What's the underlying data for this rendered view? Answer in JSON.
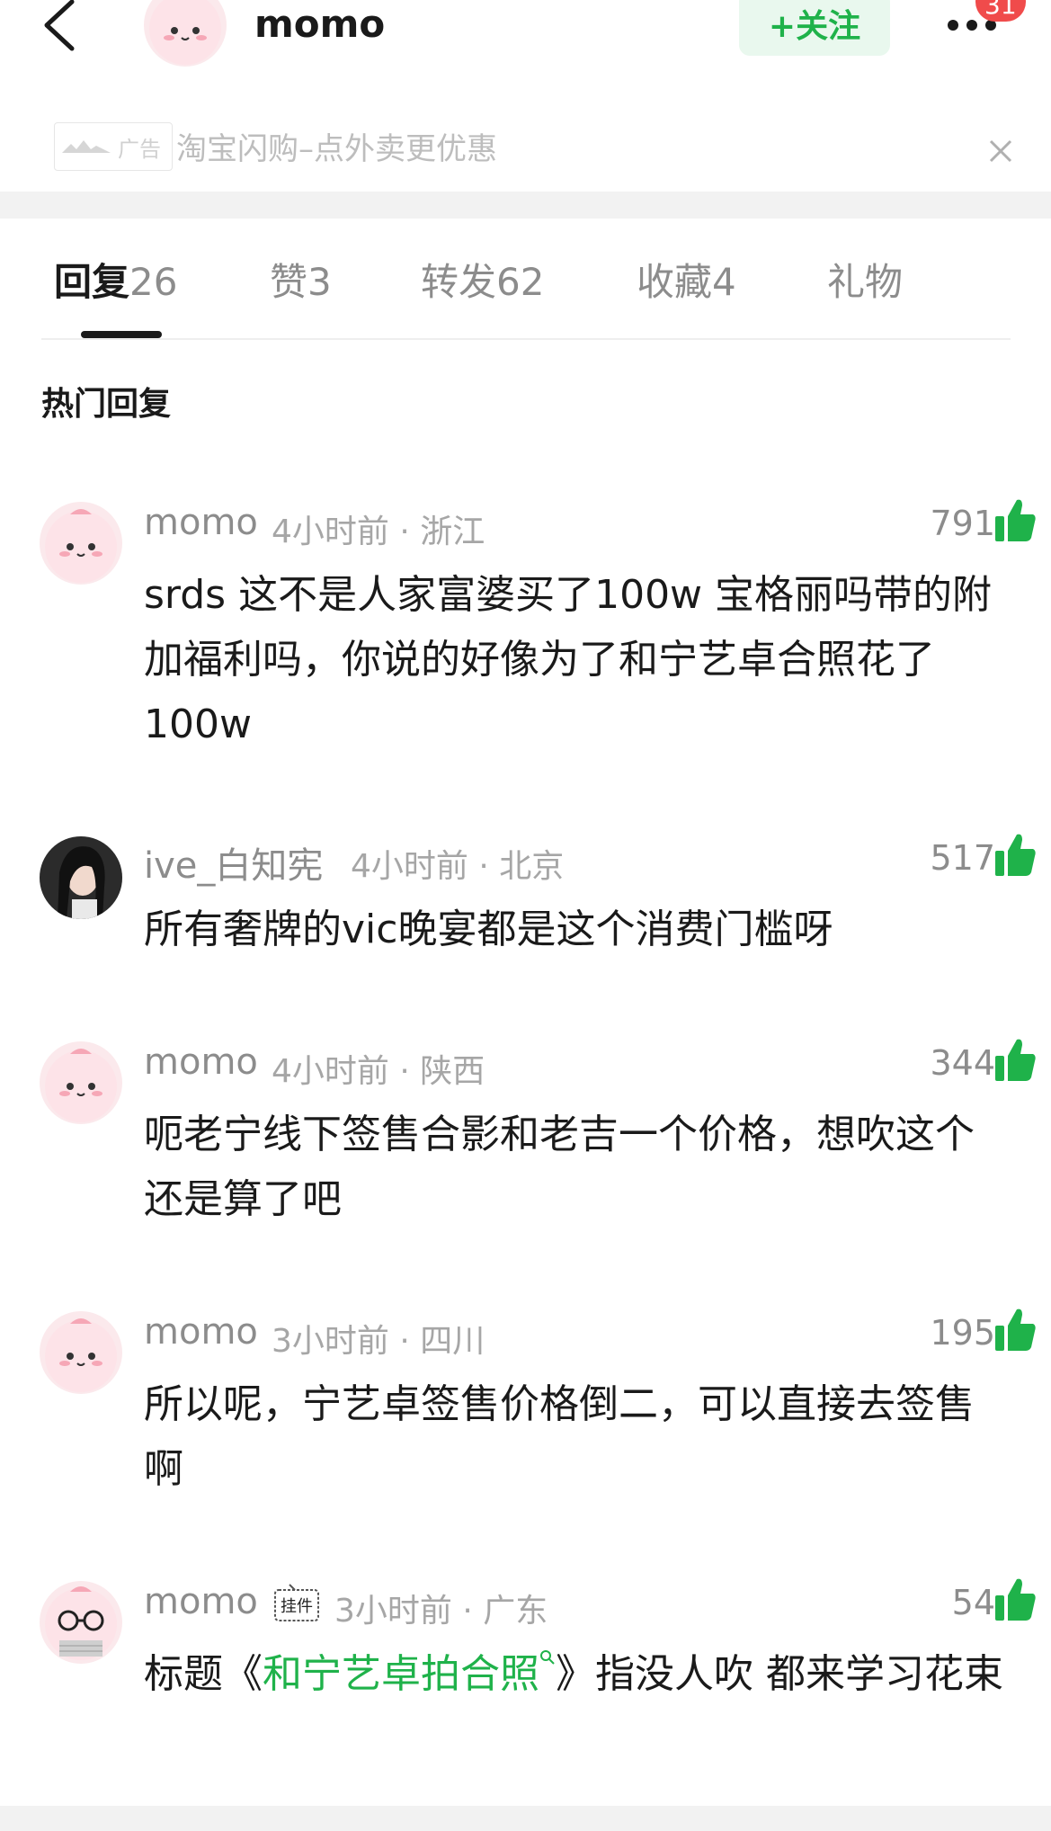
{
  "header": {
    "author_name": "momo",
    "follow_label": "+关注",
    "notification_count": "31"
  },
  "ad": {
    "badge_label": "广告",
    "text": "淘宝闪购–点外卖更优惠"
  },
  "tabs": [
    {
      "label": "回复",
      "count": "26",
      "active": true
    },
    {
      "label": "赞",
      "count": "3",
      "active": false
    },
    {
      "label": "转发",
      "count": "62",
      "active": false
    },
    {
      "label": "收藏",
      "count": "4",
      "active": false
    },
    {
      "label": "礼物",
      "count": "",
      "active": false
    }
  ],
  "section_title": "热门回复",
  "comments": [
    {
      "username": "momo",
      "time": "4小时前",
      "location": "浙江",
      "meta": "4小时前 · 浙江",
      "likes": "791",
      "text": "srds 这不是人家富婆买了100w 宝格丽吗带的附加福利吗，你说的好像为了和宁艺卓合照花了100w"
    },
    {
      "username": "ive_白知宪",
      "time": "4小时前",
      "location": "北京",
      "meta": "4小时前 · 北京",
      "likes": "517",
      "text": "所有奢牌的vic晚宴都是这个消费门槛呀"
    },
    {
      "username": "momo",
      "time": "4小时前",
      "location": "陕西",
      "meta": "4小时前 · 陕西",
      "likes": "344",
      "text": "呃老宁线下签售合影和老吉一个价格，想吹这个还是算了吧"
    },
    {
      "username": "momo",
      "time": "3小时前",
      "location": "四川",
      "meta": "3小时前 · 四川",
      "likes": "195",
      "text": "所以呢，宁艺卓签售价格倒二，可以直接去签售啊"
    },
    {
      "username": "momo",
      "time": "3小时前",
      "location": "广东",
      "meta": "3小时前 · 广东",
      "likes": "54",
      "pendant_label": "挂件",
      "text_before": "标题《",
      "topic": "和宁艺卓拍合照",
      "text_after": "》指没人吹 都来学习花束"
    }
  ],
  "colors": {
    "accent_green": "#1fb24a",
    "follow_bg": "#e9f8ee",
    "badge_red": "#f04b4b",
    "muted_text": "#8c8c8c"
  },
  "icons": [
    "back-arrow-icon",
    "more-dots-icon",
    "close-icon",
    "thumbs-up-icon",
    "search-icon",
    "ad-logo-icon"
  ]
}
